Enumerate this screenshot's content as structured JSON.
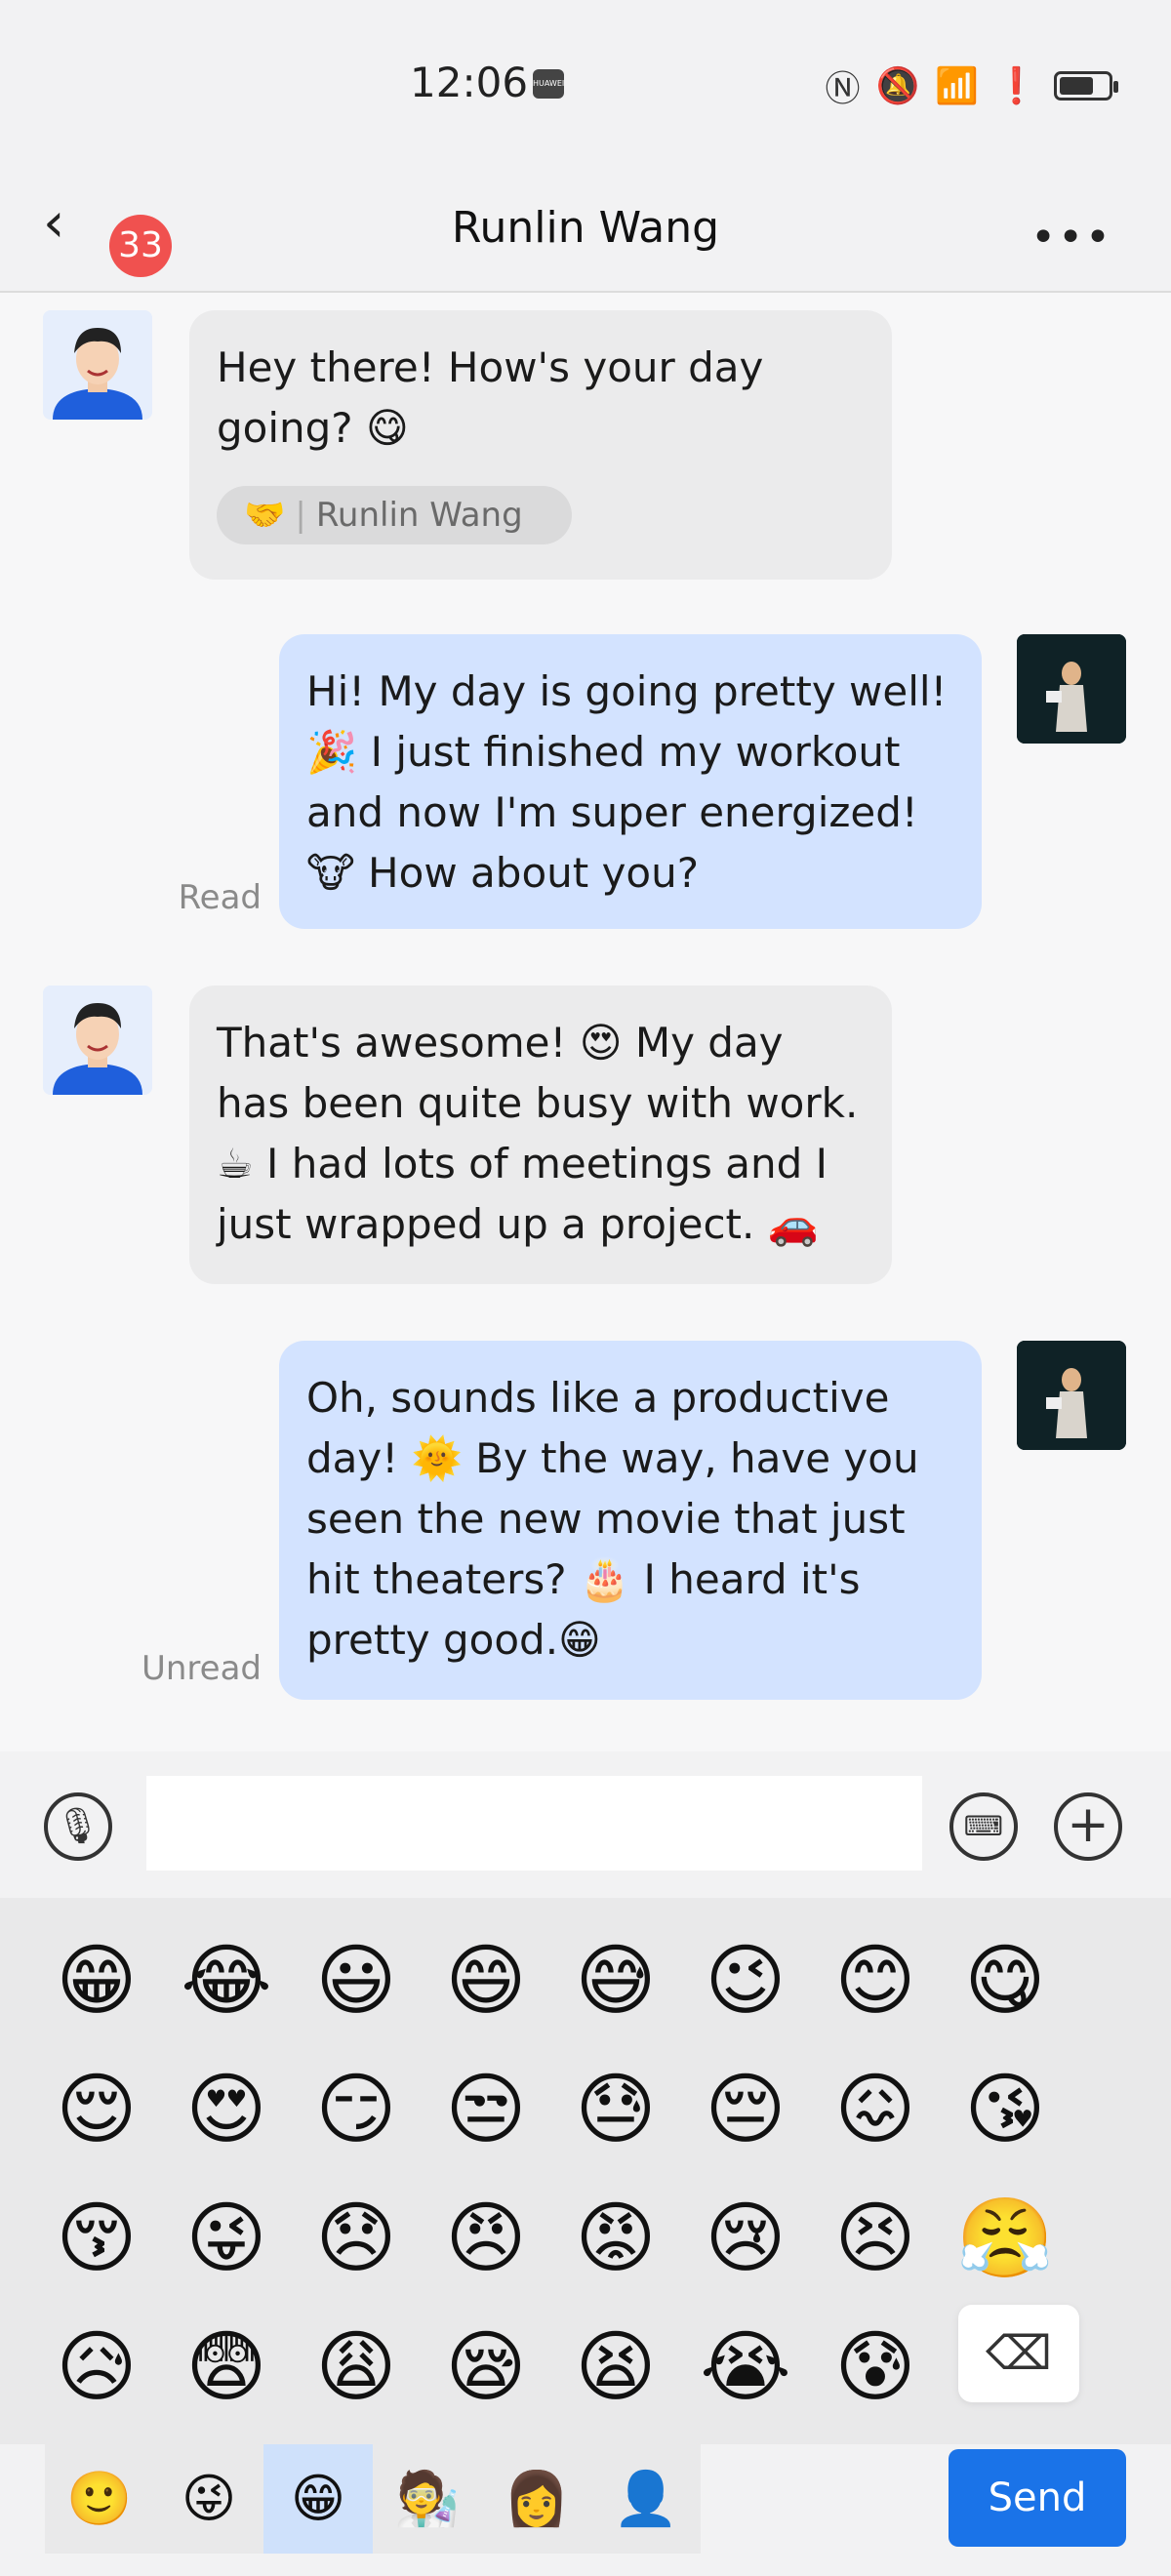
{
  "status_bar": {
    "time": "12:06",
    "carrier_chip": "HUAWEI",
    "icons": [
      "nfc-icon",
      "mute-icon",
      "wifi-icon",
      "alert-icon",
      "battery-icon"
    ]
  },
  "header": {
    "unread_count": "33",
    "title": "Runlin Wang"
  },
  "messages": [
    {
      "side": "in",
      "text": "Hey there! How's your day going? 😋",
      "tag_emoji": "🤝",
      "tag_name": "Runlin Wang"
    },
    {
      "side": "out",
      "text": "Hi! My day is going pretty well! 🎉 I just finished my workout and now I'm super energized! 🐮 How about you?",
      "status": "Read"
    },
    {
      "side": "in",
      "text": "That's awesome! 😍 My day has been quite busy with work. ☕ I had lots of meetings and I just wrapped up a project. 🚗"
    },
    {
      "side": "out",
      "text": "Oh, sounds like a productive day! 🌞 By the way, have you seen the new movie that just hit theaters? 🎂 I heard it's pretty good.😁",
      "status": "Unread"
    }
  ],
  "input": {
    "value": "",
    "placeholder": ""
  },
  "emoji_grid": [
    "😁",
    "😂",
    "😃",
    "😄",
    "😅",
    "😉",
    "😊",
    "😋",
    "😌",
    "😍",
    "😏",
    "😒",
    "😓",
    "😔",
    "😖",
    "😘",
    "😚",
    "😜",
    "😞",
    "😠",
    "😡",
    "😢",
    "😣",
    "😤",
    "😥",
    "😨",
    "😩",
    "😪",
    "😫",
    "😭",
    "😰"
  ],
  "backspace_label": "⌫",
  "tabs": [
    "🙂",
    "😜",
    "😁",
    "🧑‍🔬",
    "👩",
    "👤"
  ],
  "send_label": "Send"
}
